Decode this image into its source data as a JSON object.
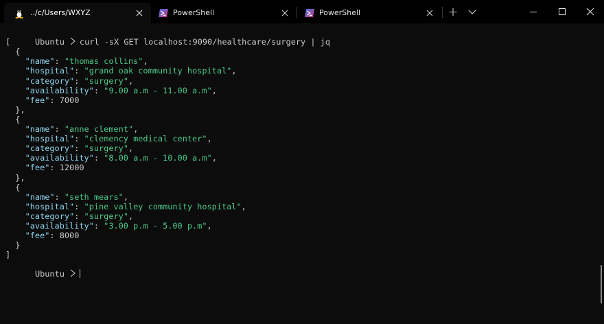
{
  "tabs": [
    {
      "title": "../c/Users/WXYZ",
      "icon": "linux-tux-icon",
      "active": true
    },
    {
      "title": "PowerShell",
      "icon": "powershell-icon",
      "active": false
    },
    {
      "title": "PowerShell",
      "icon": "powershell-icon",
      "active": false
    }
  ],
  "titlebar": {
    "new_tab_glyph": "+",
    "dropdown_glyph": "chevron-down-icon"
  },
  "terminal": {
    "prompt": "Ubuntu",
    "command": "curl -sX GET localhost:9090/healthcare/surgery | jq",
    "open_bracket": "[",
    "close_bracket": "]",
    "records": [
      {
        "name": "thomas collins",
        "hospital": "grand oak community hospital",
        "category": "surgery",
        "availability": "9.00 a.m - 11.00 a.m",
        "fee": "7000"
      },
      {
        "name": "anne clement",
        "hospital": "clemency medical center",
        "category": "surgery",
        "availability": "8.00 a.m - 10.00 a.m",
        "fee": "12000"
      },
      {
        "name": "seth mears",
        "hospital": "pine valley community hospital",
        "category": "surgery",
        "availability": "3.00 p.m - 5.00 p.m",
        "fee": "8000"
      }
    ],
    "keys": {
      "name": "\"name\"",
      "hospital": "\"hospital\"",
      "category": "\"category\"",
      "availability": "\"availability\"",
      "fee": "\"fee\""
    }
  },
  "colors": {
    "background": "#0c0c0c",
    "titlebar": "#000000",
    "key": "#8fd5ee",
    "string": "#4ec98a",
    "text": "#cccccc"
  }
}
